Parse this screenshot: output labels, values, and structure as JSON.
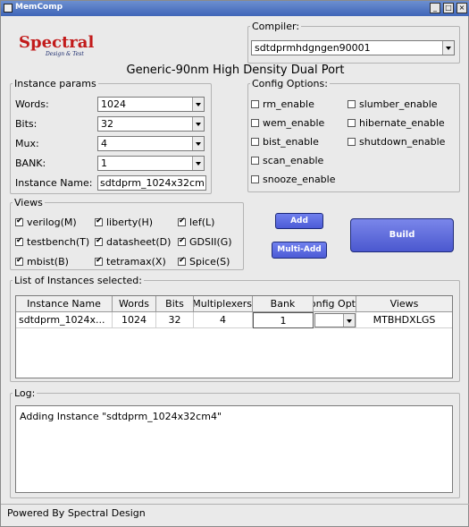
{
  "window": {
    "title": "MemComp"
  },
  "logo": {
    "brand": "Spectral",
    "tagline": "Design & Test"
  },
  "compiler": {
    "label": "Compiler:",
    "value": "sdtdprmhdgngen90001"
  },
  "heading": "Generic-90nm High Density Dual Port",
  "instance_params": {
    "title": "Instance params",
    "words_label": "Words:",
    "words_value": "1024",
    "bits_label": "Bits:",
    "bits_value": "32",
    "mux_label": "Mux:",
    "mux_value": "4",
    "bank_label": "BANK:",
    "bank_value": "1",
    "name_label": "Instance Name:",
    "name_value": "sdtdprm_1024x32cm"
  },
  "config_options": {
    "title": "Config Options:",
    "rm": "rm_enable",
    "slumber": "slumber_enable",
    "wem": "wem_enable",
    "hibernate": "hibernate_enable",
    "bist": "bist_enable",
    "shutdown": "shutdown_enable",
    "scan": "scan_enable",
    "snooze": "snooze_enable"
  },
  "views": {
    "title": "Views",
    "verilog": "verilog(M)",
    "liberty": "liberty(H)",
    "lef": "lef(L)",
    "testbench": "testbench(T)",
    "datasheet": "datasheet(D)",
    "gdsii": "GDSII(G)",
    "mbist": "mbist(B)",
    "tetramax": "tetramax(X)",
    "spice": "Spice(S)"
  },
  "buttons": {
    "add": "Add",
    "multi_add": "Multi-Add",
    "build": "Build"
  },
  "instances": {
    "title": "List of Instances selected:",
    "headers": [
      "Instance Name",
      "Words",
      "Bits",
      "Multiplexers",
      "Bank",
      "Config Opt",
      "Views"
    ],
    "rows": [
      {
        "name": "sdtdprm_1024x...",
        "words": "1024",
        "bits": "32",
        "mux": "4",
        "bank": "1",
        "config": "",
        "views": "MTBHDXLGS"
      }
    ]
  },
  "log": {
    "title": "Log:",
    "text": "Adding Instance \"sdtdprm_1024x32cm4\""
  },
  "footer": {
    "text": "Powered By Spectral Design"
  },
  "colors": {
    "button_blue": "#5b68dd",
    "title_blue": "#3f65b8",
    "logo_red": "#c21a1a",
    "logo_navy": "#1a2a6c"
  }
}
